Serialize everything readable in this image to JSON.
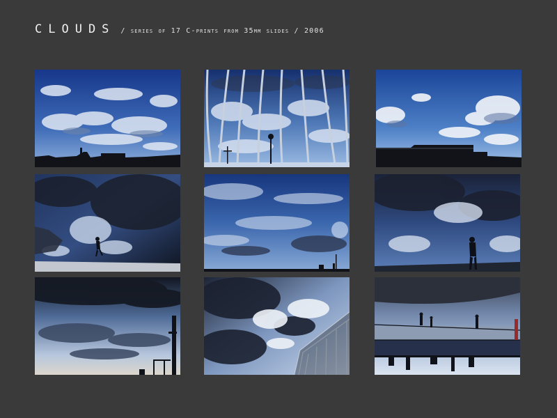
{
  "header": {
    "title": "CLOUDS",
    "subtitle": "/ series of 17 C-prints from 35mm slides / 2006"
  },
  "colors": {
    "background": "#3a3a3a",
    "text": "#f0f0f0",
    "sky_deep": "#1c3f86",
    "sky_light": "#9fc0e8",
    "cloud": "#dfe6f2",
    "cloud_dark": "#2a3140",
    "silhouette": "#101318"
  },
  "gallery": {
    "photos": [
      {
        "subject": "blue sky with scattered clouds over rooftop silhouettes"
      },
      {
        "subject": "clouds seen through curved metal bars with a street lamp"
      },
      {
        "subject": "blue sky with bright clouds over a building silhouette"
      },
      {
        "subject": "dark storm clouds with a person silhouette on a ramp"
      },
      {
        "subject": "wide blue sky with wispy clouds over a low skyline"
      },
      {
        "subject": "dark clouds with a person standing at the bottom"
      },
      {
        "subject": "dark cloud bank over a bright horizon with a post"
      },
      {
        "subject": "sunlit clouds beside a curved glass structure"
      },
      {
        "subject": "inverted view of a railing with walking figures and reflected skyline"
      }
    ]
  }
}
